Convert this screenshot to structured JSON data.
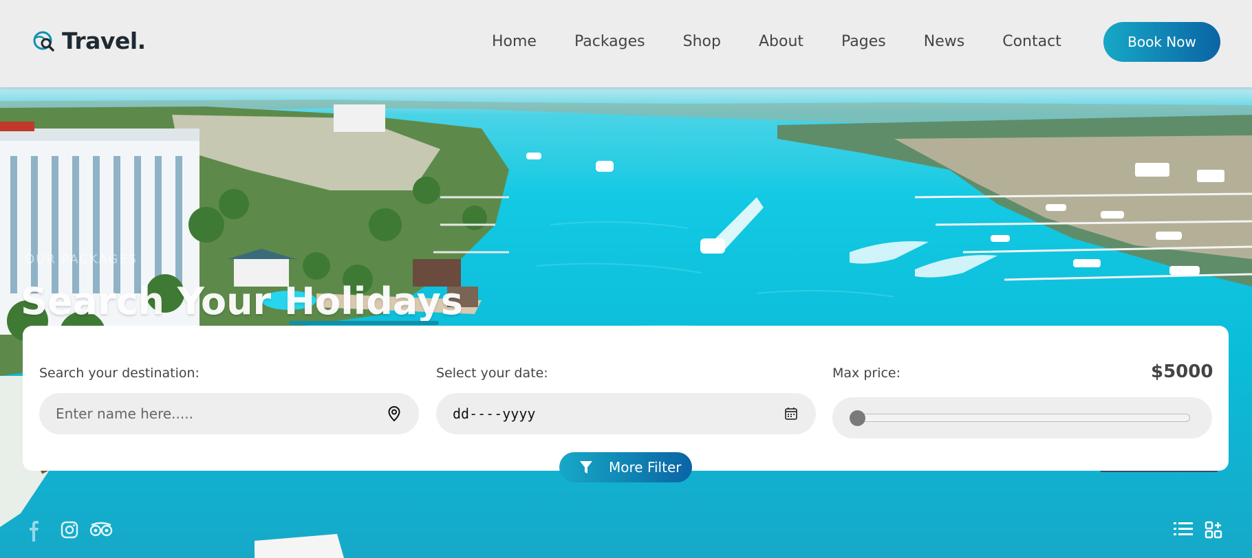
{
  "brand": {
    "name": "Travel."
  },
  "nav": {
    "items": [
      "Home",
      "Packages",
      "Shop",
      "About",
      "Pages",
      "News",
      "Contact"
    ],
    "cta_label": "Book Now"
  },
  "hero": {
    "kicker": "OUR PACKAGES",
    "title": "Search Your Holidays"
  },
  "search": {
    "destination": {
      "label": "Search your destination:",
      "placeholder": "Enter name here.....",
      "icon": "map-pin-icon"
    },
    "date": {
      "label": "Select your date:",
      "value": "dd----yyyy",
      "icon": "calendar-icon"
    },
    "price": {
      "label": "Max price:",
      "value": "$5000",
      "slider_fraction": 0.0
    },
    "more_filter_label": "More Filter"
  },
  "social": [
    "facebook-icon",
    "instagram-icon",
    "tripadvisor-icon"
  ],
  "views": [
    "list-view-icon",
    "grid-view-icon"
  ],
  "colors": {
    "accent_start": "#17a8c6",
    "accent_end": "#0a64a4",
    "header_bg": "#ededed"
  }
}
